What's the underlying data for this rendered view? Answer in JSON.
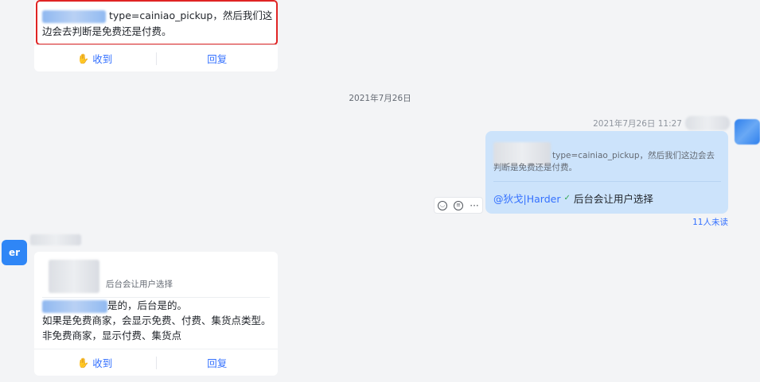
{
  "top_message": {
    "text": "type=cainiao_pickup，然后我们这边会去判断是免费还是付费。",
    "actions": {
      "received": "收到",
      "reply": "回复"
    }
  },
  "date_separator": "2021年7月26日",
  "right_message": {
    "timestamp": "2021年7月26日 11:27",
    "quote_text": "type=cainiao_pickup，然后我们这边会去判断是免费还是付费。",
    "mention": "@狄戈|Harder",
    "reply_text": "后台会让用户选择",
    "unread": "11人未读"
  },
  "left_message": {
    "avatar_text": "er",
    "quote_text": "后台会让用户选择",
    "text_line1": "是的，后台是的。",
    "text_line2": "如果是免费商家，会显示免费、付费、集货点类型。非免费商家，显示付费、集货点",
    "actions": {
      "received": "收到",
      "reply": "回复"
    }
  },
  "colors": {
    "accent": "#3370ff",
    "highlight_border": "#e02424",
    "bubble": "#cce3fb"
  },
  "icons": [
    "hand-icon",
    "verified-icon",
    "emoji-icon",
    "reply-thread-icon",
    "more-icon"
  ]
}
